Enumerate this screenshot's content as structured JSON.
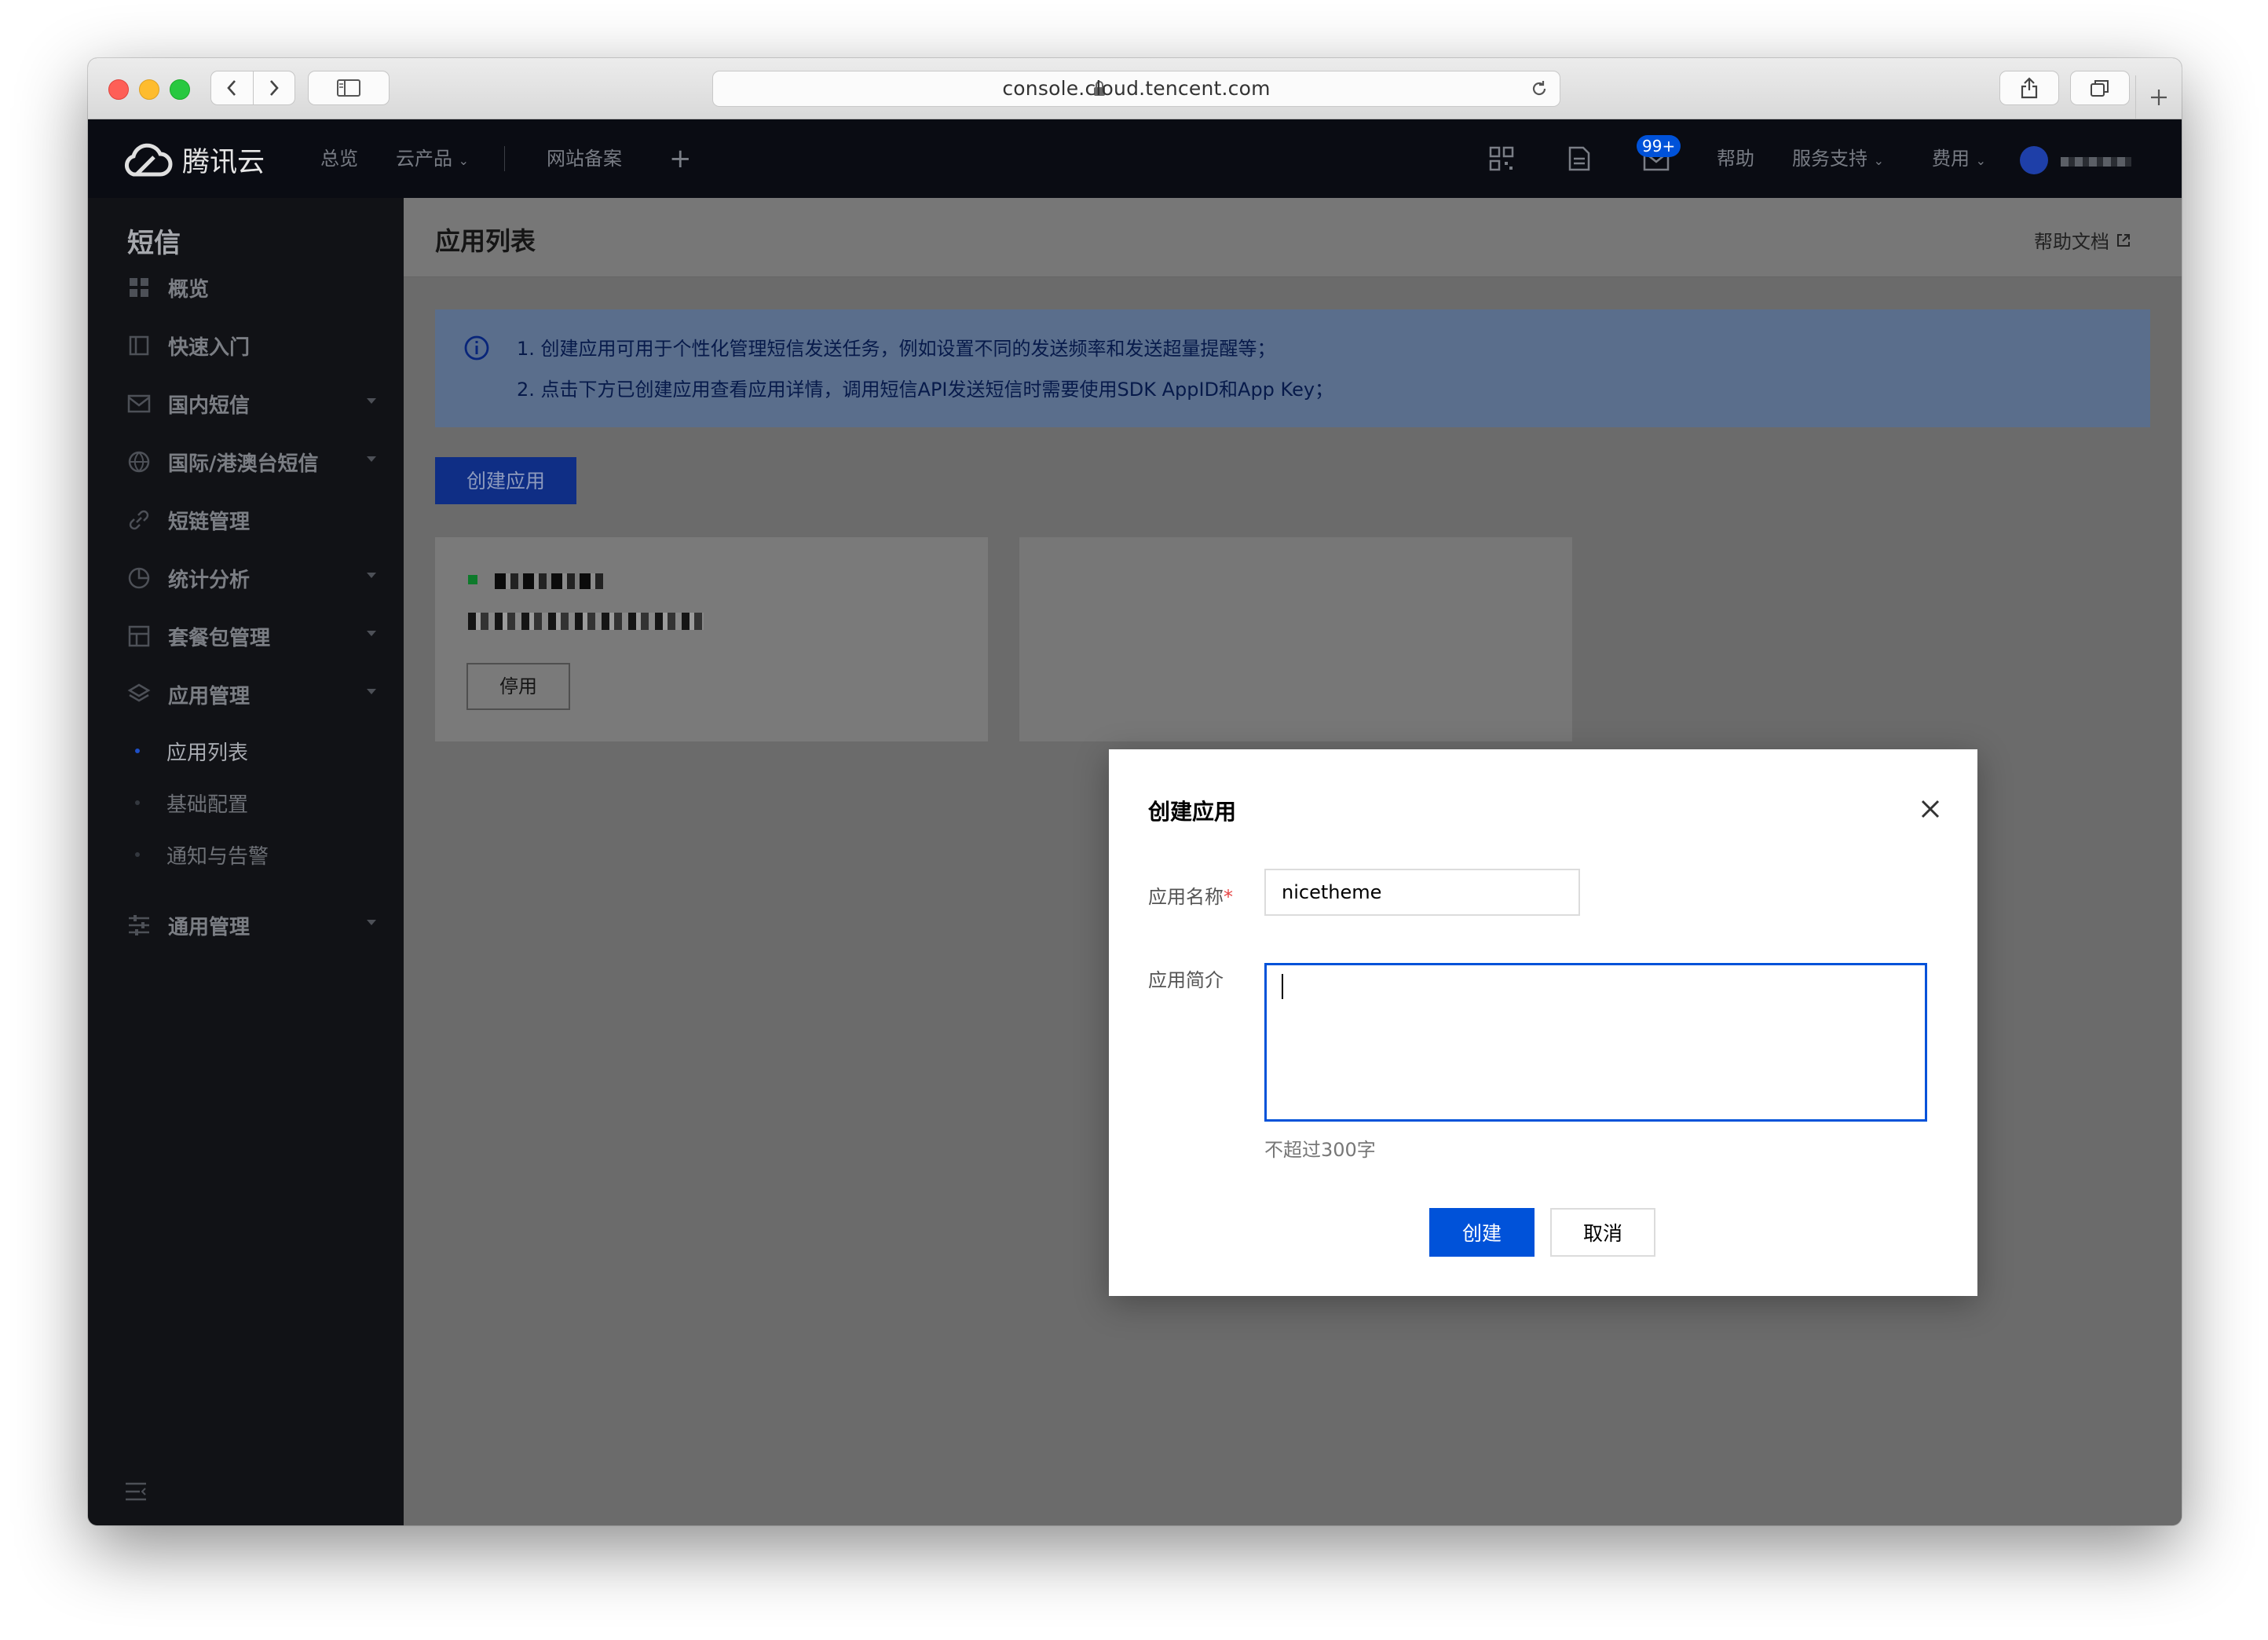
{
  "browser": {
    "url": "console.cloud.tencent.com"
  },
  "topnav": {
    "brand": "腾讯云",
    "links": [
      "总览",
      "云产品",
      "网站备案"
    ],
    "badge": "99+",
    "help": "帮助",
    "service": "服务支持",
    "fees": "费用"
  },
  "sidebar": {
    "title": "短信",
    "items": [
      {
        "label": "概览",
        "icon": "grid-icon"
      },
      {
        "label": "快速入门",
        "icon": "book-icon"
      },
      {
        "label": "国内短信",
        "icon": "mail-icon"
      },
      {
        "label": "国际/港澳台短信",
        "icon": "globe-icon"
      },
      {
        "label": "短链管理",
        "icon": "link-icon"
      },
      {
        "label": "统计分析",
        "icon": "chart-icon"
      },
      {
        "label": "套餐包管理",
        "icon": "package-icon"
      },
      {
        "label": "应用管理",
        "icon": "layers-icon"
      }
    ],
    "subitems": [
      "应用列表",
      "基础配置",
      "通知与告警"
    ],
    "general": "通用管理"
  },
  "page": {
    "title": "应用列表",
    "help_doc": "帮助文档",
    "info_lines": [
      "1. 创建应用可用于个性化管理短信发送任务，例如设置不同的发送频率和发送超量提醒等；",
      "2. 点击下方已创建应用查看应用详情，调用短信API发送短信时需要使用SDK AppID和App Key；"
    ],
    "create_button": "创建应用",
    "card_button": "停用"
  },
  "modal": {
    "title": "创建应用",
    "name_label": "应用名称",
    "name_required": "*",
    "name_value": "nicetheme",
    "desc_label": "应用简介",
    "desc_value": "",
    "hint": "不超过300字",
    "create": "创建",
    "cancel": "取消"
  }
}
